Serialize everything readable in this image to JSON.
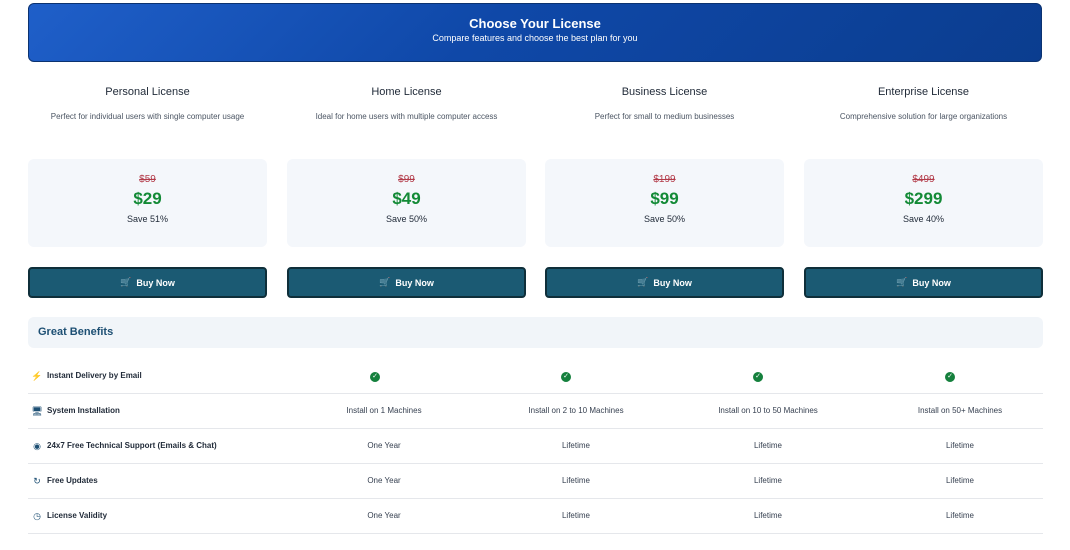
{
  "header": {
    "title": "Choose Your License",
    "subtitle": "Compare features and choose the best plan for you"
  },
  "plans": [
    {
      "name": "Personal License",
      "description": "Perfect for individual users with single computer usage",
      "old_price": "$59",
      "price": "$29",
      "save": "Save 51%",
      "buy_label": "Buy Now"
    },
    {
      "name": "Home License",
      "description": "Ideal for home users with multiple computer access",
      "old_price": "$99",
      "price": "$49",
      "save": "Save 50%",
      "buy_label": "Buy Now"
    },
    {
      "name": "Business License",
      "description": "Perfect for small to medium businesses",
      "old_price": "$199",
      "price": "$99",
      "save": "Save 50%",
      "buy_label": "Buy Now"
    },
    {
      "name": "Enterprise License",
      "description": "Comprehensive solution for large organizations",
      "old_price": "$499",
      "price": "$299",
      "save": "Save 40%",
      "buy_label": "Buy Now"
    }
  ],
  "benefits": {
    "title": "Great Benefits",
    "rows": [
      {
        "icon": "bolt-icon",
        "label": "Instant Delivery by Email",
        "values": [
          "check",
          "check",
          "check",
          "check"
        ]
      },
      {
        "icon": "monitor-icon",
        "label": "System Installation",
        "values": [
          "Install on 1 Machines",
          "Install on 2 to 10 Machines",
          "Install on 10 to 50 Machines",
          "Install on 50+ Machines"
        ]
      },
      {
        "icon": "lifebuoy-icon",
        "label": "24x7 Free Technical Support (Emails & Chat)",
        "values": [
          "One Year",
          "Lifetime",
          "Lifetime",
          "Lifetime"
        ]
      },
      {
        "icon": "refresh-icon",
        "label": "Free Updates",
        "values": [
          "One Year",
          "Lifetime",
          "Lifetime",
          "Lifetime"
        ]
      },
      {
        "icon": "clock-icon",
        "label": "License Validity",
        "values": [
          "One Year",
          "Lifetime",
          "Lifetime",
          "Lifetime"
        ]
      }
    ]
  },
  "colors": {
    "banner": "#0f48a8",
    "price_new": "#138a36",
    "price_old": "#b23a48",
    "buy_button": "#1b5a73"
  }
}
